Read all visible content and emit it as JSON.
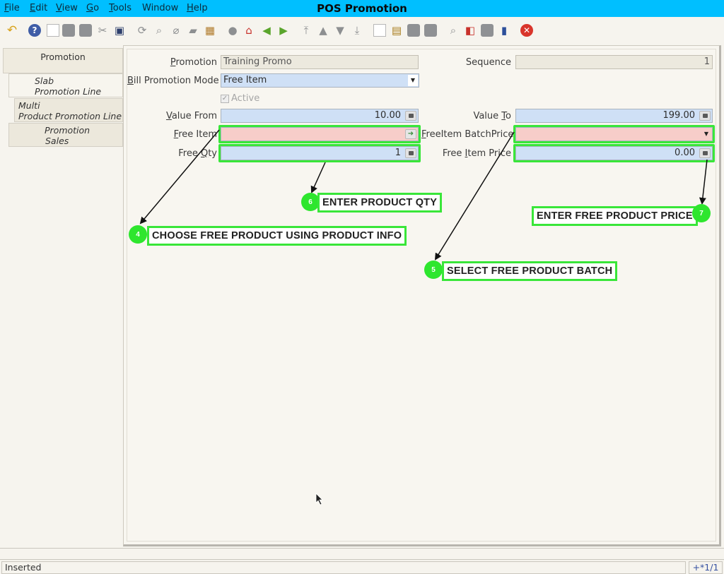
{
  "window": {
    "title": "POS Promotion"
  },
  "menu": [
    {
      "label": "File",
      "underline": "F",
      "rest": "ile"
    },
    {
      "label": "Edit",
      "underline": "E",
      "rest": "dit"
    },
    {
      "label": "View",
      "underline": "V",
      "rest": "iew"
    },
    {
      "label": "Go",
      "underline": "G",
      "rest": "o"
    },
    {
      "label": "Tools",
      "underline": "T",
      "rest": "ools"
    },
    {
      "label": "Window",
      "underline": "",
      "rest": "Window"
    },
    {
      "label": "Help",
      "underline": "H",
      "rest": "elp"
    }
  ],
  "toolbar": {
    "icons": [
      "undo-icon",
      "help-icon",
      "new-record-icon",
      "copy-record-icon",
      "delete-icon",
      "delete-selection-icon",
      "save-icon",
      "refresh-icon",
      "find-icon",
      "attachment-icon",
      "chat-icon",
      "grid-toggle-icon",
      "history-icon",
      "home-icon",
      "back-icon",
      "forward-icon",
      "first-record-icon",
      "previous-record-icon",
      "next-record-icon",
      "last-record-icon",
      "report-icon",
      "archive-icon",
      "print-preview-icon",
      "print-icon",
      "zoom-across-icon",
      "request-icon",
      "product-info-icon",
      "workflow-icon",
      "close-window-icon"
    ]
  },
  "tabs": [
    {
      "line1": "Promotion",
      "line2": ""
    },
    {
      "line1": "Slab",
      "line2": "Promotion Line"
    },
    {
      "line1": "Multi",
      "line2": "Product Promotion Line"
    },
    {
      "line1": "Promotion",
      "line2": "Sales"
    }
  ],
  "form": {
    "promotion": {
      "label_u": "P",
      "label_rest": "romotion",
      "value": "Training Promo"
    },
    "sequence": {
      "label": "Sequence",
      "value": "1"
    },
    "bill_mode": {
      "label_u": "B",
      "label_rest": "ill Promotion Mode",
      "value": "Free Item"
    },
    "active": {
      "label": "Active"
    },
    "value_from": {
      "label_u": "V",
      "label_rest": "alue From",
      "value": "10.00"
    },
    "value_to": {
      "label_pre": "Value ",
      "label_u": "T",
      "label_rest": "o",
      "value": "199.00"
    },
    "free_item": {
      "label_u": "F",
      "label_rest": "ree Item",
      "value": ""
    },
    "free_item_batch": {
      "label_u": "F",
      "label_rest": "reeItem BatchPrice",
      "value": ""
    },
    "free_qty": {
      "label_pre": "Free ",
      "label_u": "Q",
      "label_rest": "ty",
      "value": "1"
    },
    "free_item_price": {
      "label_pre": "Free ",
      "label_u": "I",
      "label_rest": "tem Price",
      "value": "0.00"
    }
  },
  "annotations": [
    {
      "num": "4",
      "text": "CHOOSE FREE PRODUCT USING PRODUCT INFO"
    },
    {
      "num": "5",
      "text": "SELECT FREE PRODUCT BATCH"
    },
    {
      "num": "6",
      "text": "ENTER PRODUCT QTY"
    },
    {
      "num": "7",
      "text": "ENTER FREE PRODUCT PRICE"
    }
  ],
  "status": {
    "message": "Inserted",
    "record": "+*1/1"
  },
  "colors": {
    "titlebar": "#00bfff",
    "highlight": "#39e639",
    "mandatory": "#f7cdc9",
    "editable": "#cfe0f6"
  }
}
